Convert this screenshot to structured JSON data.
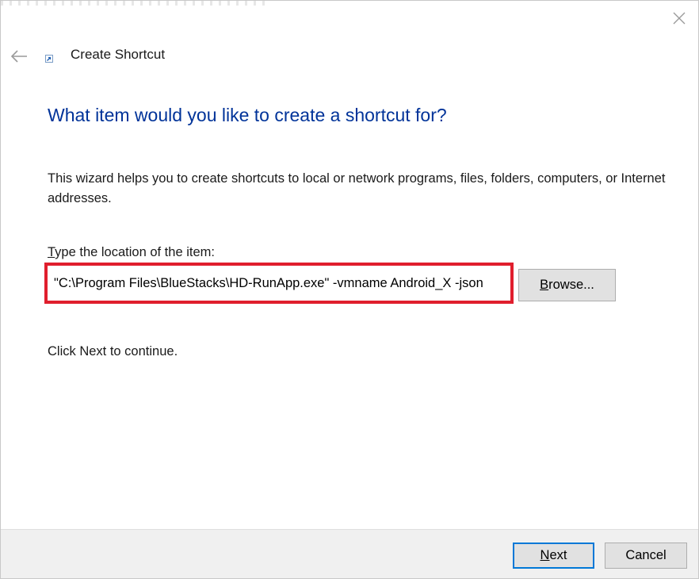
{
  "window": {
    "title": "Create Shortcut"
  },
  "main": {
    "heading": "What item would you like to create a shortcut for?",
    "description": "This wizard helps you to create shortcuts to local or network programs, files, folders, computers, or Internet addresses.",
    "location_label_first": "T",
    "location_label_rest": "ype the location of the item:",
    "location_value": "\"C:\\Program Files\\BlueStacks\\HD-RunApp.exe\" -vmname Android_X -json",
    "browse_label_first": "B",
    "browse_label_rest": "rowse...",
    "continue_text": "Click Next to continue."
  },
  "footer": {
    "next_label_first": "N",
    "next_label_rest": "ext",
    "cancel_label": "Cancel"
  },
  "colors": {
    "heading": "#003399",
    "highlight_border": "#e01e2d",
    "button_bg": "#e1e1e1",
    "default_button_border": "#0078d7",
    "footer_bg": "#f0f0f0"
  },
  "icons": {
    "close": "close-icon",
    "back": "back-arrow-icon",
    "shortcut": "shortcut-icon"
  }
}
